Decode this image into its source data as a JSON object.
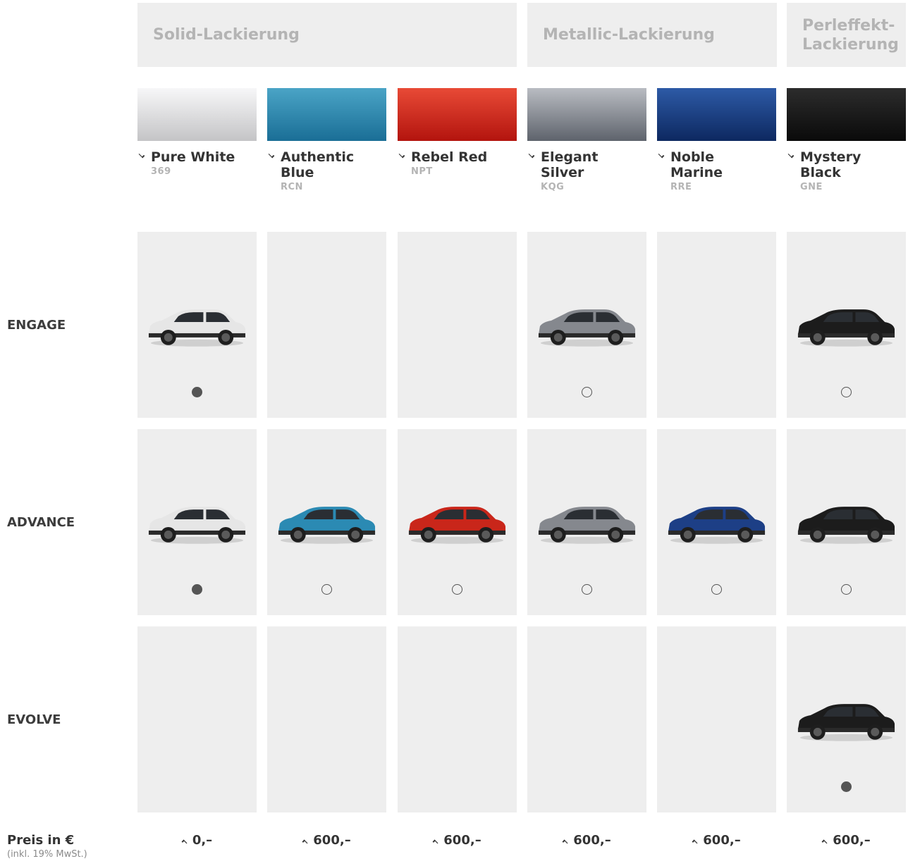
{
  "categories": [
    {
      "label": "Solid-Lackierung"
    },
    {
      "label": "Metallic-Lackierung"
    },
    {
      "label": "Perleffekt-Lackierung"
    }
  ],
  "colors": [
    {
      "name": "Pure White",
      "code": "369",
      "swatch_top": "#f7f7f8",
      "swatch_bottom": "#c4c4c6",
      "body": "#e6e6e6"
    },
    {
      "name": "Authentic Blue",
      "code": "RCN",
      "swatch_top": "#4aa4c6",
      "swatch_bottom": "#1a6e96",
      "body": "#2b8ab3"
    },
    {
      "name": "Rebel Red",
      "code": "NPT",
      "swatch_top": "#e84a36",
      "swatch_bottom": "#b3140e",
      "body": "#c9261a"
    },
    {
      "name": "Elegant Silver",
      "code": "KQG",
      "swatch_top": "#b9bcc2",
      "swatch_bottom": "#5e636c",
      "body": "#85888e"
    },
    {
      "name": "Noble Marine",
      "code": "RRE",
      "swatch_top": "#2d5aa6",
      "swatch_bottom": "#0d2860",
      "body": "#1d3f86"
    },
    {
      "name": "Mystery Black",
      "code": "GNE",
      "swatch_top": "#2c2c2c",
      "swatch_bottom": "#0a0a0a",
      "body": "#1c1c1c"
    }
  ],
  "trims": [
    {
      "label": "ENGAGE",
      "available": [
        true,
        false,
        false,
        true,
        false,
        true
      ],
      "selected": 0
    },
    {
      "label": "ADVANCE",
      "available": [
        true,
        true,
        true,
        true,
        true,
        true
      ],
      "selected": 0
    },
    {
      "label": "EVOLVE",
      "available": [
        false,
        false,
        false,
        false,
        false,
        true
      ],
      "selected": 5
    }
  ],
  "price": {
    "label": "Preis in €",
    "sublabel": "(inkl. 19% MwSt.)",
    "values": [
      "0,–",
      "600,–",
      "600,–",
      "600,–",
      "600,–",
      "600,–"
    ]
  }
}
